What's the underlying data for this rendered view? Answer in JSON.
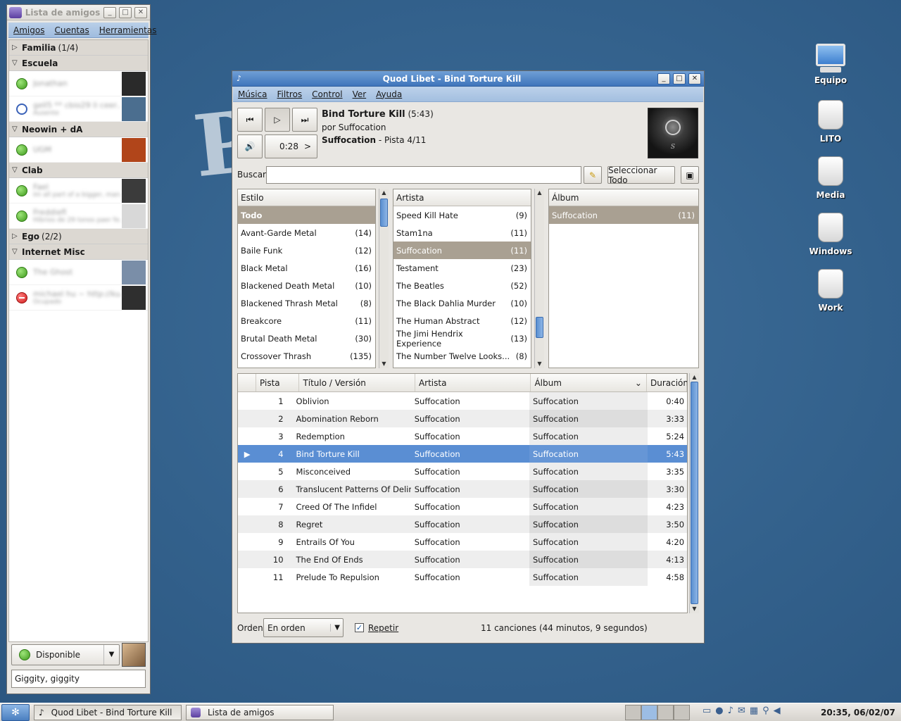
{
  "buddy_list": {
    "title": "Lista de amigos",
    "menu": [
      "Amigos",
      "Cuentas",
      "Herramientas"
    ],
    "groups": [
      {
        "name": "Familia",
        "count": "(1/4)",
        "expanded": false,
        "buddies": []
      },
      {
        "name": "Escuela",
        "count": "",
        "expanded": true,
        "buddies": [
          {
            "name": "Jonathan",
            "sub": "",
            "status": "available",
            "avatar_color": "#2a2a2a"
          },
          {
            "name": "gell5 ** cbio29 li ceer...",
            "sub": "Ausente",
            "status": "away",
            "avatar_color": "#4b6e8f"
          }
        ]
      },
      {
        "name": "Neowin + dA",
        "count": "",
        "expanded": true,
        "buddies": [
          {
            "name": "UGM",
            "sub": "",
            "status": "available",
            "avatar_color": "#b1451a"
          }
        ]
      },
      {
        "name": "Clab",
        "count": "",
        "expanded": true,
        "buddies": [
          {
            "name": "Fael",
            "sub": "Im all part of a bigger, man...",
            "status": "available",
            "avatar_color": "#3b3b3b"
          },
          {
            "name": "Freddiefl",
            "sub": "Hibrios de 29 tonos paer fe...",
            "status": "available",
            "avatar_color": "#d8d8d8"
          }
        ]
      },
      {
        "name": "Ego",
        "count": "(2/2)",
        "expanded": false,
        "buddies": []
      },
      {
        "name": "Internet Misc",
        "count": "",
        "expanded": true,
        "buddies": [
          {
            "name": "The Ghost",
            "sub": "",
            "status": "available",
            "avatar_color": "#7a8ea8"
          },
          {
            "name": "michael hu ~ http://ku...",
            "sub": "Ocupado",
            "status": "busy",
            "avatar_color": "#2f2f2f"
          }
        ]
      }
    ],
    "status_label": "Disponible",
    "status_message": "Giggity, giggity"
  },
  "player": {
    "title": "Quod Libet - Bind Torture Kill",
    "menu": [
      "Música",
      "Filtros",
      "Control",
      "Ver",
      "Ayuda"
    ],
    "now_playing": {
      "title": "Bind Torture Kill",
      "length": "(5:43)",
      "by_line": "por Suffocation",
      "album": "Suffocation",
      "track_info": "- Pista 4/11",
      "position": "0:28",
      "position_arrow": ">"
    },
    "search_label": "Buscar",
    "select_all_label": "Seleccionar Todo",
    "genre_pane": {
      "header": "Estilo",
      "all_label": "Todo",
      "items": [
        {
          "name": "Avant-Garde Metal",
          "count": "(14)"
        },
        {
          "name": "Baile Funk",
          "count": "(12)"
        },
        {
          "name": "Black Metal",
          "count": "(16)"
        },
        {
          "name": "Blackened Death Metal",
          "count": "(10)"
        },
        {
          "name": "Blackened Thrash Metal",
          "count": "(8)"
        },
        {
          "name": "Breakcore",
          "count": "(11)"
        },
        {
          "name": "Brutal Death Metal",
          "count": "(30)"
        },
        {
          "name": "Crossover Thrash",
          "count": "(135)"
        }
      ]
    },
    "artist_pane": {
      "header": "Artista",
      "items": [
        {
          "name": "Speed Kill Hate",
          "count": "(9)",
          "selected": false
        },
        {
          "name": "Stam1na",
          "count": "(11)",
          "selected": false
        },
        {
          "name": "Suffocation",
          "count": "(11)",
          "selected": true
        },
        {
          "name": "Testament",
          "count": "(23)",
          "selected": false
        },
        {
          "name": "The Beatles",
          "count": "(52)",
          "selected": false
        },
        {
          "name": "The Black Dahlia Murder",
          "count": "(10)",
          "selected": false
        },
        {
          "name": "The Human Abstract",
          "count": "(12)",
          "selected": false
        },
        {
          "name": "The Jimi Hendrix Experience",
          "count": "(13)",
          "selected": false
        },
        {
          "name": "The Number Twelve Looks...",
          "count": "(8)",
          "selected": false
        }
      ]
    },
    "album_pane": {
      "header": "Álbum",
      "items": [
        {
          "name": "Suffocation",
          "count": "(11)",
          "selected": true
        }
      ]
    },
    "song_columns": [
      "Pista",
      "Título / Versión",
      "Artista",
      "Álbum",
      "Duración"
    ],
    "songs": [
      {
        "track": "1",
        "title": "Oblivion",
        "artist": "Suffocation",
        "album": "Suffocation",
        "duration": "0:40"
      },
      {
        "track": "2",
        "title": "Abomination Reborn",
        "artist": "Suffocation",
        "album": "Suffocation",
        "duration": "3:33"
      },
      {
        "track": "3",
        "title": "Redemption",
        "artist": "Suffocation",
        "album": "Suffocation",
        "duration": "5:24"
      },
      {
        "track": "4",
        "title": "Bind Torture Kill",
        "artist": "Suffocation",
        "album": "Suffocation",
        "duration": "5:43",
        "playing": true
      },
      {
        "track": "5",
        "title": "Misconceived",
        "artist": "Suffocation",
        "album": "Suffocation",
        "duration": "3:35"
      },
      {
        "track": "6",
        "title": "Translucent Patterns Of Delir...",
        "artist": "Suffocation",
        "album": "Suffocation",
        "duration": "3:30"
      },
      {
        "track": "7",
        "title": "Creed Of The Infidel",
        "artist": "Suffocation",
        "album": "Suffocation",
        "duration": "4:23"
      },
      {
        "track": "8",
        "title": "Regret",
        "artist": "Suffocation",
        "album": "Suffocation",
        "duration": "3:50"
      },
      {
        "track": "9",
        "title": "Entrails Of You",
        "artist": "Suffocation",
        "album": "Suffocation",
        "duration": "4:20"
      },
      {
        "track": "10",
        "title": "The End Of Ends",
        "artist": "Suffocation",
        "album": "Suffocation",
        "duration": "4:13"
      },
      {
        "track": "11",
        "title": "Prelude To Repulsion",
        "artist": "Suffocation",
        "album": "Suffocation",
        "duration": "4:58"
      }
    ],
    "order_label": "Orden",
    "order_value": "En orden",
    "repeat_label": "Repetir",
    "repeat_checked": true,
    "summary": "11 canciones (44 minutos, 9 segundos)"
  },
  "desktop_icons": [
    {
      "label": "Equipo",
      "icon": "computer-icon"
    },
    {
      "label": "LITO",
      "icon": "drive-icon"
    },
    {
      "label": "Media",
      "icon": "drive-icon"
    },
    {
      "label": "Windows",
      "icon": "drive-icon"
    },
    {
      "label": "Work",
      "icon": "drive-icon"
    }
  ],
  "taskbar": {
    "tasks": [
      "Quod Libet - Bind Torture Kill",
      "Lista de amigos"
    ],
    "clock": "20:35, 06/02/07"
  },
  "colors": {
    "desktop": "#33618c",
    "selection": "#5a8ed3",
    "pane_selection": "#a9a092"
  }
}
